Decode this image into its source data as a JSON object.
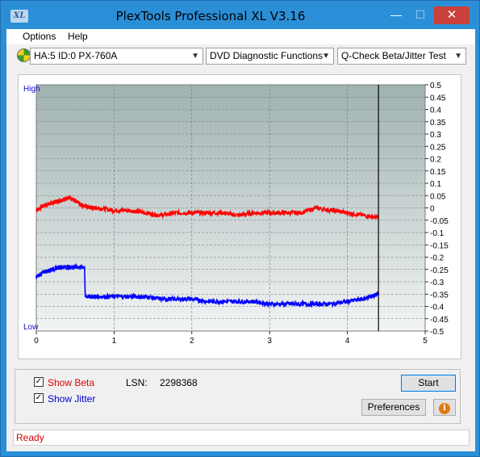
{
  "window": {
    "title": "PlexTools Professional XL V3.16",
    "icon_text": "XL",
    "minimize": "—",
    "maximize": "☐",
    "close": "✕"
  },
  "menu": {
    "options": "Options",
    "help": "Help"
  },
  "toolbar": {
    "drive": "HA:5 ID:0  PX-760A",
    "function": "DVD Diagnostic Functions",
    "test": "Q-Check Beta/Jitter Test",
    "arrow": "▼"
  },
  "chart_data": {
    "type": "line",
    "x_ticks": [
      "0",
      "1",
      "2",
      "3",
      "4",
      "5"
    ],
    "xlim": [
      0,
      5
    ],
    "y_right_ticks": [
      "0.5",
      "0.45",
      "0.4",
      "0.35",
      "0.3",
      "0.25",
      "0.2",
      "0.15",
      "0.1",
      "0.05",
      "0",
      "-0.05",
      "-0.1",
      "-0.15",
      "-0.2",
      "-0.25",
      "-0.3",
      "-0.35",
      "-0.4",
      "-0.45",
      "-0.5"
    ],
    "ylim": [
      -0.5,
      0.5
    ],
    "y_left_top": "High",
    "y_left_bottom": "Low",
    "end_marker_x": 4.4,
    "series": [
      {
        "name": "Beta",
        "color": "#ff0000",
        "x": [
          0.0,
          0.1,
          0.2,
          0.3,
          0.4,
          0.5,
          0.6,
          0.7,
          0.8,
          1.0,
          1.2,
          1.4,
          1.6,
          1.8,
          2.0,
          2.2,
          2.4,
          2.6,
          2.8,
          3.0,
          3.2,
          3.4,
          3.6,
          3.8,
          4.0,
          4.2,
          4.4
        ],
        "y": [
          -0.01,
          0.01,
          0.02,
          0.03,
          0.04,
          0.03,
          0.01,
          0.0,
          0.0,
          -0.01,
          -0.01,
          -0.02,
          -0.03,
          -0.02,
          -0.02,
          -0.02,
          -0.02,
          -0.03,
          -0.02,
          -0.02,
          -0.02,
          -0.02,
          0.0,
          -0.01,
          -0.02,
          -0.03,
          -0.04
        ]
      },
      {
        "name": "Jitter",
        "color": "#0000ff",
        "x": [
          0.0,
          0.1,
          0.2,
          0.3,
          0.4,
          0.5,
          0.62,
          0.63,
          0.7,
          0.8,
          1.0,
          1.2,
          1.4,
          1.6,
          1.8,
          2.0,
          2.2,
          2.4,
          2.6,
          2.8,
          3.0,
          3.2,
          3.4,
          3.6,
          3.8,
          4.0,
          4.2,
          4.3,
          4.4
        ],
        "y": [
          -0.28,
          -0.26,
          -0.25,
          -0.24,
          -0.24,
          -0.24,
          -0.24,
          -0.36,
          -0.36,
          -0.36,
          -0.36,
          -0.36,
          -0.36,
          -0.37,
          -0.37,
          -0.37,
          -0.38,
          -0.38,
          -0.38,
          -0.38,
          -0.39,
          -0.39,
          -0.39,
          -0.39,
          -0.39,
          -0.38,
          -0.37,
          -0.36,
          -0.35
        ]
      }
    ]
  },
  "panel": {
    "show_beta": "Show Beta",
    "show_jitter": "Show Jitter",
    "check_mark": "✓",
    "lsn_label": "LSN:",
    "lsn_value": "2298368",
    "start": "Start",
    "preferences": "Preferences",
    "info": "i"
  },
  "status": {
    "text": "Ready"
  }
}
